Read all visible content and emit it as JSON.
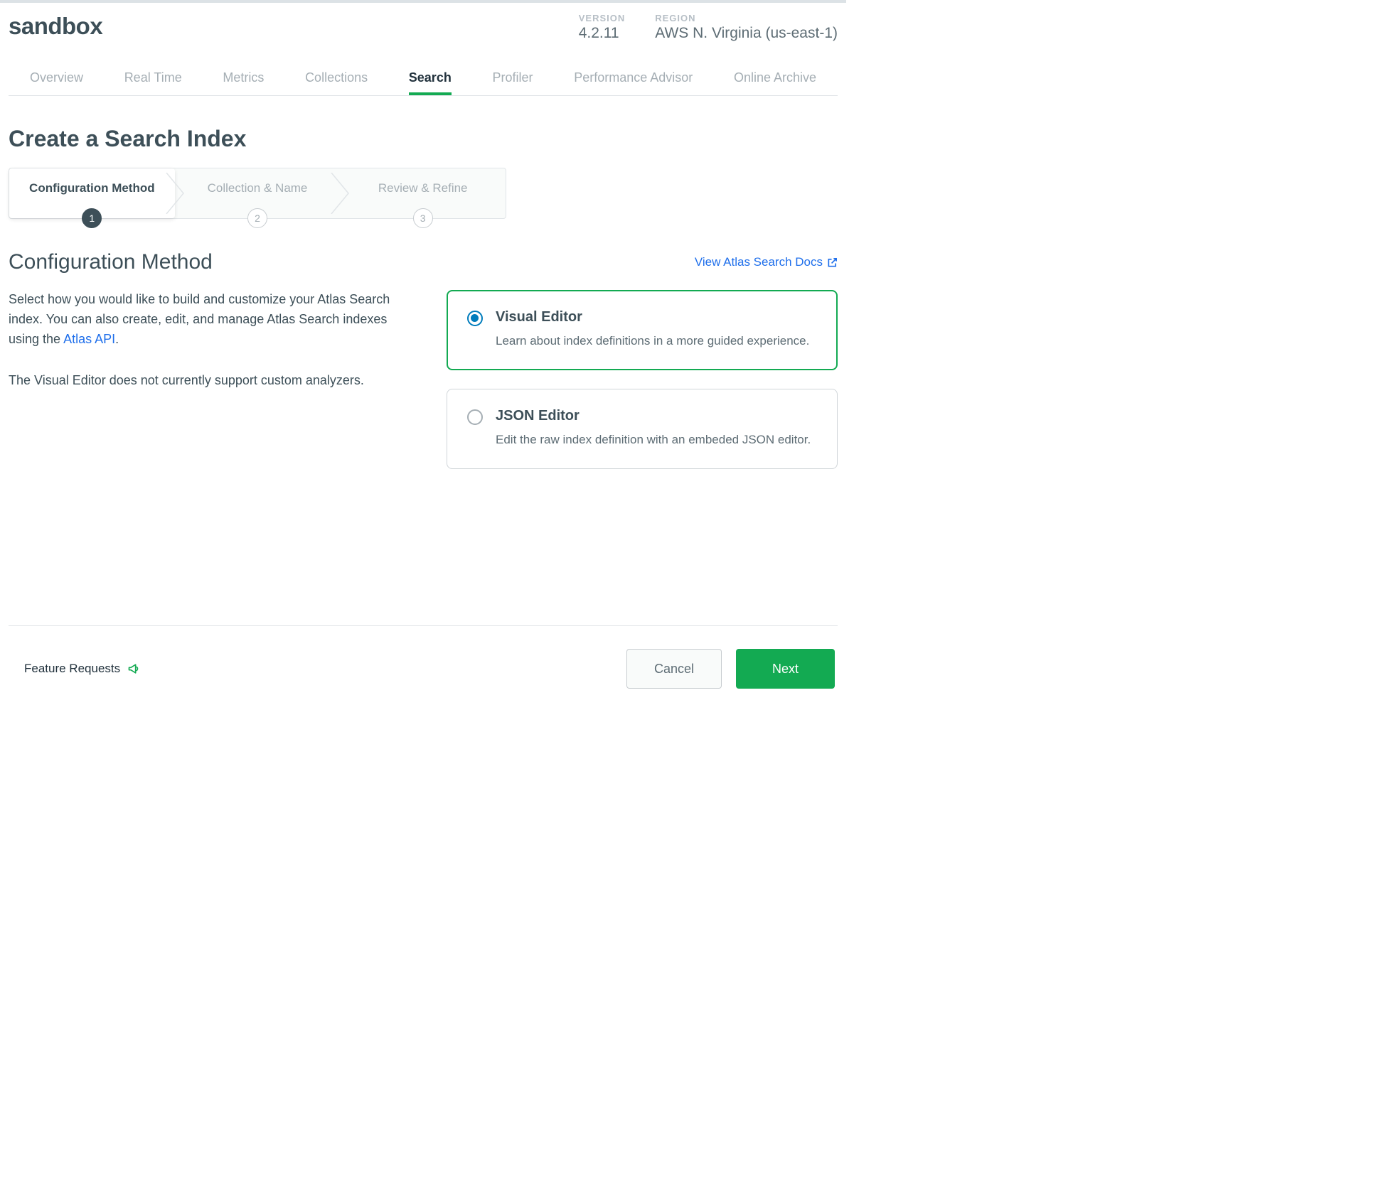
{
  "header": {
    "clusterName": "sandbox",
    "versionLabel": "VERSION",
    "versionValue": "4.2.11",
    "regionLabel": "REGION",
    "regionValue": "AWS N. Virginia (us-east-1)"
  },
  "tabs": [
    {
      "label": "Overview",
      "active": false
    },
    {
      "label": "Real Time",
      "active": false
    },
    {
      "label": "Metrics",
      "active": false
    },
    {
      "label": "Collections",
      "active": false
    },
    {
      "label": "Search",
      "active": true
    },
    {
      "label": "Profiler",
      "active": false
    },
    {
      "label": "Performance Advisor",
      "active": false
    },
    {
      "label": "Online Archive",
      "active": false
    }
  ],
  "pageTitle": "Create a Search Index",
  "steps": [
    {
      "label": "Configuration Method",
      "num": "1",
      "active": true
    },
    {
      "label": "Collection & Name",
      "num": "2",
      "active": false
    },
    {
      "label": "Review & Refine",
      "num": "3",
      "active": false
    }
  ],
  "section": {
    "title": "Configuration Method",
    "docsLink": "View Atlas Search Docs",
    "para1a": "Select how you would like to build and customize your Atlas Search index. You can also create, edit, and manage Atlas Search indexes using the ",
    "para1Link": "Atlas API",
    "para1b": ".",
    "para2": "The Visual Editor does not currently support custom analyzers."
  },
  "options": [
    {
      "title": "Visual Editor",
      "desc": "Learn about index definitions in a more guided experience.",
      "selected": true
    },
    {
      "title": "JSON Editor",
      "desc": "Edit the raw index definition with an embeded JSON editor.",
      "selected": false
    }
  ],
  "footer": {
    "featureRequests": "Feature Requests",
    "cancel": "Cancel",
    "next": "Next"
  }
}
